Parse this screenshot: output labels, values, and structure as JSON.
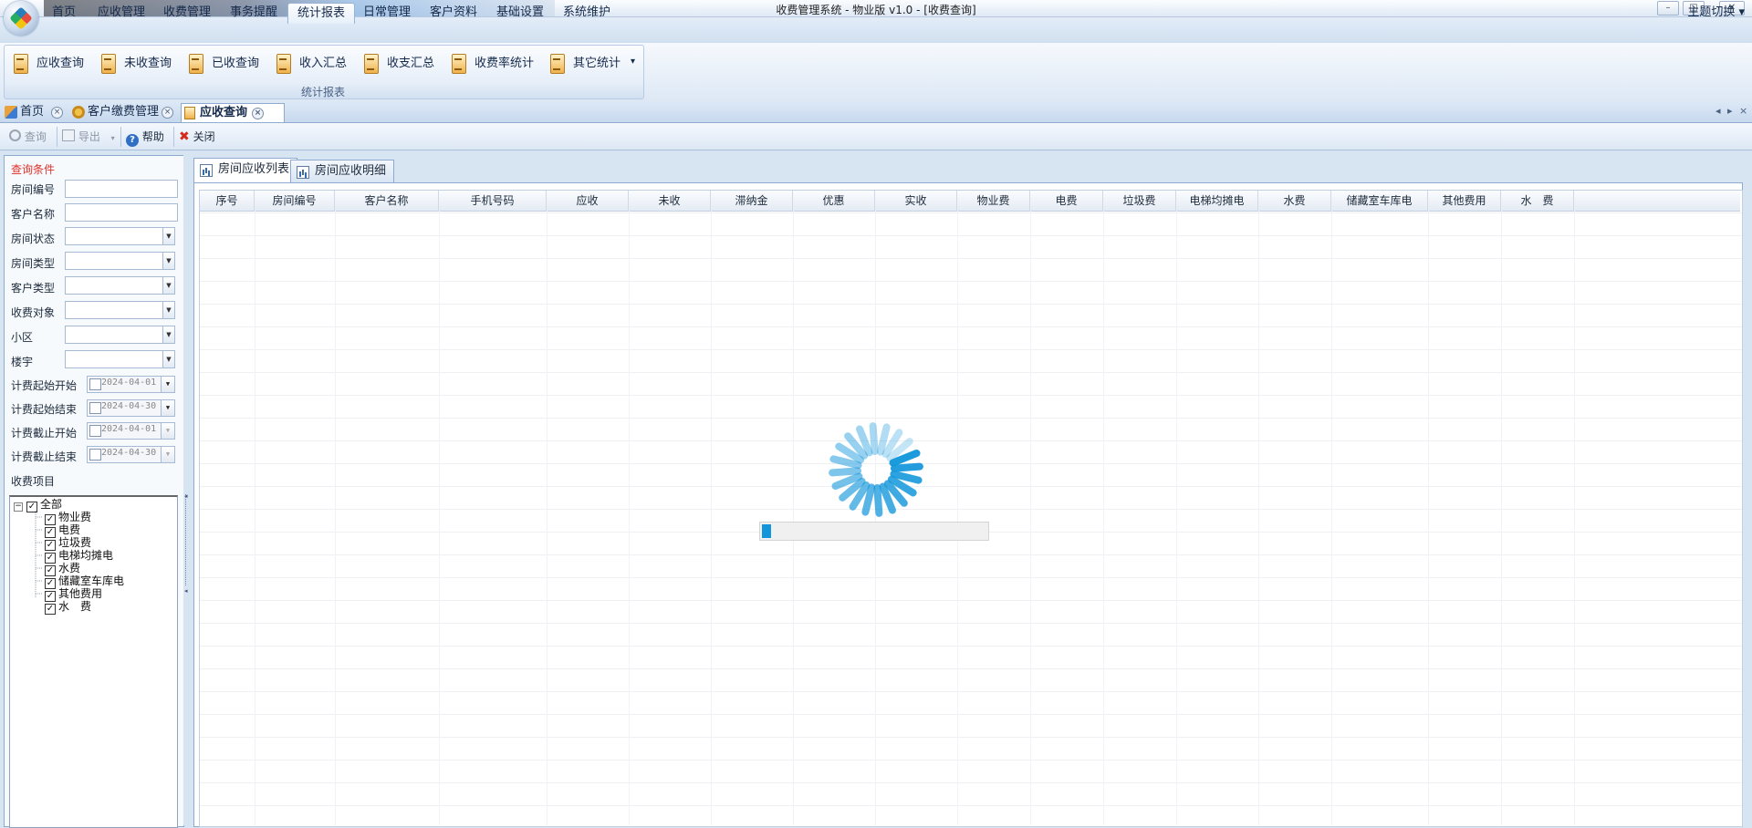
{
  "window": {
    "title": "收费管理系统 - 物业版 v1.0 - [收费查询]",
    "controls": [
      "–",
      "□",
      "✕"
    ]
  },
  "menu": {
    "tabs": [
      "首页",
      "应收管理",
      "收费管理",
      "事务提醒",
      "统计报表",
      "日常管理",
      "客户资料",
      "基础设置",
      "系统维护"
    ],
    "active_index": 4,
    "theme_switch": "主题切换"
  },
  "ribbon": {
    "buttons": [
      "应收查询",
      "未收查询",
      "已收查询",
      "收入汇总",
      "收支汇总",
      "收费率统计",
      "其它统计"
    ],
    "dropdown_arrow": "▾",
    "group_label": "统计报表"
  },
  "doc_tabs": {
    "items": [
      "首页",
      "客户缴费管理",
      "应收查询"
    ],
    "active_index": 2,
    "close_glyph": "×",
    "nav": [
      "◂",
      "▸",
      "×"
    ]
  },
  "toolbar": {
    "query": "查询",
    "export": "导出",
    "help": "帮助",
    "close": "关闭"
  },
  "filters": {
    "section_title": "查询条件",
    "room_no": "房间编号",
    "customer_name": "客户名称",
    "room_status": "房间状态",
    "room_type": "房间类型",
    "customer_type": "客户类型",
    "charge_target": "收费对象",
    "community": "小区",
    "building": "楼宇",
    "bill_start_from": "计费起始开始",
    "bill_start_to": "计费起始结束",
    "bill_end_from": "计费截止开始",
    "bill_end_to": "计费截止结束",
    "date_values": [
      "2024-04-01",
      "2024-04-30",
      "2024-04-01",
      "2024-04-30"
    ],
    "items_title": "收费项目"
  },
  "tree": {
    "root": "全部",
    "children": [
      "物业费",
      "电费",
      "垃圾费",
      "电梯均摊电",
      "水费",
      "储藏室车库电",
      "其他费用",
      "水　费"
    ]
  },
  "grid_tabs": [
    "房间应收列表",
    "房间应收明细"
  ],
  "grid": {
    "columns": [
      "序号",
      "房间编号",
      "客户名称",
      "手机号码",
      "应收",
      "未收",
      "滞纳金",
      "优惠",
      "实收",
      "物业费",
      "电费",
      "垃圾费",
      "电梯均摊电",
      "水费",
      "储藏室车库电",
      "其他费用",
      "水　费"
    ]
  },
  "loading": {
    "progress": 0.04,
    "color": "#1296db"
  },
  "colors": {
    "accent": "#1296db",
    "section_title": "#e0302a",
    "close_red": "#d42a1c"
  }
}
